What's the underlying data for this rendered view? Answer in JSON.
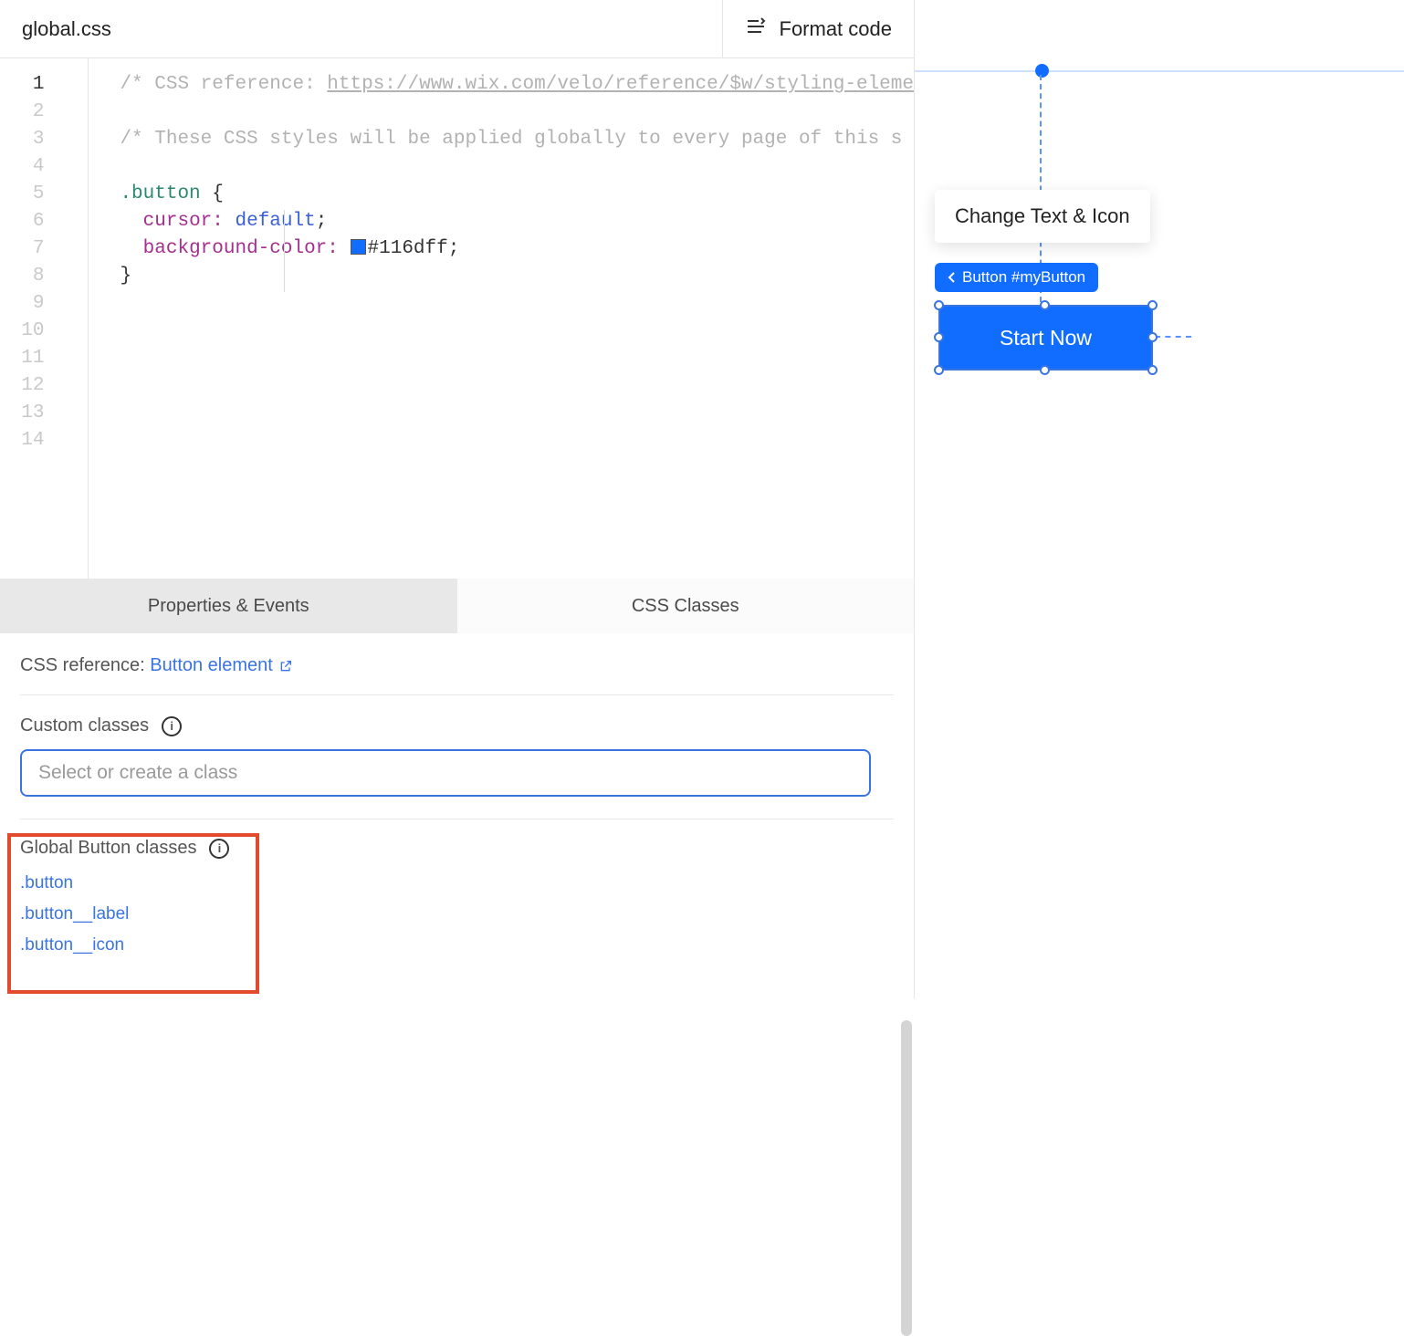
{
  "toolbar": {
    "filename": "global.css",
    "format_label": "Format code"
  },
  "editor": {
    "line_count": 14,
    "active_line": 1,
    "comment1_prefix": "/* CSS reference: ",
    "comment1_link": "https://www.wix.com/velo/reference/$w/styling-eleme",
    "comment2": "/* These CSS styles will be applied globally to every page of this s",
    "selector": ".button",
    "brace_open": "{",
    "prop1": "cursor:",
    "val1": "default",
    "semi": ";",
    "prop2": "background-color:",
    "val2": "#116dff",
    "brace_close": "}"
  },
  "panel": {
    "tab_props": "Properties & Events",
    "tab_css": "CSS Classes",
    "ref_label": "CSS reference:",
    "ref_link": "Button element",
    "custom_label": "Custom classes",
    "placeholder": "Select or create a class",
    "global_label": "Global Button classes",
    "classes": [
      ".button",
      ".button__label",
      ".button__icon"
    ]
  },
  "preview": {
    "tooltip": "Change Text & Icon",
    "breadcrumb": "Button #myButton",
    "button_label": "Start Now"
  }
}
